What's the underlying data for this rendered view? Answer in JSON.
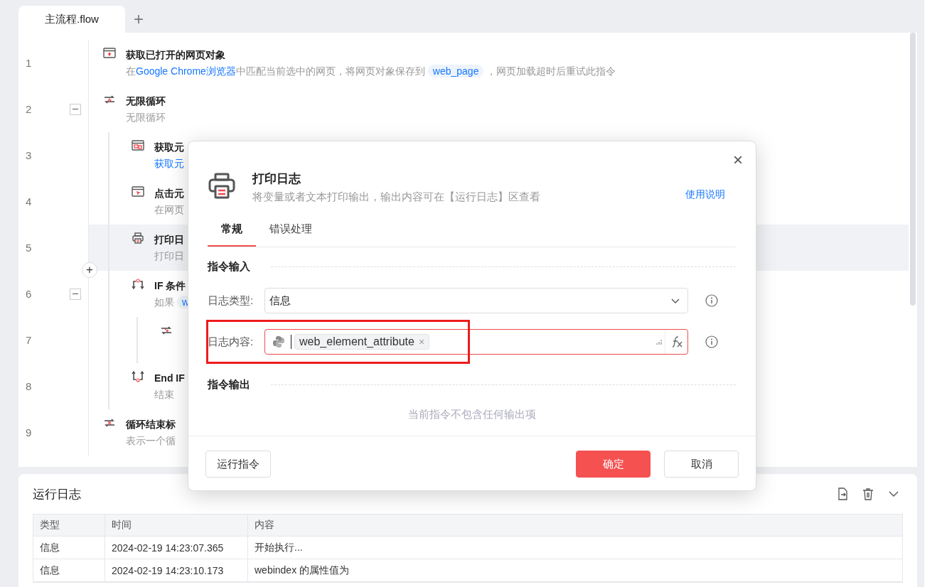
{
  "editor": {
    "tabs": [
      {
        "label": "主流程.flow",
        "selected": true
      }
    ],
    "add_tab": "+",
    "steps": [
      {
        "line": "1",
        "kind": "browser",
        "title": "获取已打开的网页对象",
        "description": [
          {
            "kind": "text",
            "text": "在"
          },
          {
            "kind": "link",
            "text": "Google Chrome浏览器"
          },
          {
            "kind": "text",
            "text": "中匹配当前选中的网页，将网页对象保存到"
          },
          {
            "kind": "tag",
            "text": "web_page"
          },
          {
            "kind": "text",
            "text": "，网页加载超时后重试此指令"
          }
        ],
        "selected": false
      },
      {
        "line": "2",
        "kind": "loop",
        "title": "无限循环",
        "description": [
          {
            "kind": "text",
            "text": "无限循环"
          }
        ],
        "selected": false,
        "expanded": true,
        "children": [
          {
            "line": "3",
            "kind": "element",
            "title": "获取元",
            "description": [
              {
                "kind": "link",
                "text": "获取元"
              }
            ],
            "selected": false
          },
          {
            "line": "4",
            "kind": "click",
            "title": "点击元",
            "description": [
              {
                "kind": "text",
                "text": "在网页"
              }
            ],
            "selected": false
          },
          {
            "line": "5",
            "kind": "printer",
            "title": "打印日",
            "description": [
              {
                "kind": "text",
                "text": "打印日"
              }
            ],
            "selected": true
          },
          {
            "line": "6",
            "kind": "if",
            "title": "IF 条件",
            "description": [
              {
                "kind": "text",
                "text": "如果"
              },
              {
                "kind": "tag",
                "text": "w"
              }
            ],
            "selected": false,
            "expanded": true,
            "children": [
              {
                "line": "7",
                "kind": "continue",
                "selected": false
              }
            ]
          },
          {
            "line": "8",
            "kind": "endif",
            "title": "End IF",
            "description": [
              {
                "kind": "text",
                "text": "结束"
              }
            ],
            "selected": false
          }
        ]
      },
      {
        "line": "9",
        "kind": "loopend",
        "title": "循环结束标",
        "description": [
          {
            "kind": "text",
            "text": "表示一个循"
          }
        ],
        "selected": false
      }
    ]
  },
  "log": {
    "title": "运行日志",
    "columns": [
      "类型",
      "时间",
      "内容"
    ],
    "rows": [
      [
        "信息",
        "2024-02-19 14:23:07.365",
        "开始执行..."
      ],
      [
        "信息",
        "2024-02-19 14:23:10.173",
        "webindex 的属性值为"
      ]
    ]
  },
  "dialog": {
    "title": "打印日志",
    "description": "将变量或者文本打印输出，输出内容可在【运行日志】区查看",
    "help_link": "使用说明",
    "close": "×",
    "tabs": [
      {
        "label": "常规",
        "selected": true
      },
      {
        "label": "错误处理",
        "selected": false
      }
    ],
    "input_section": "指令输入",
    "fields": [
      {
        "kind": "select",
        "label": "日志类型:",
        "value": "信息",
        "highlighted": false
      },
      {
        "kind": "expression",
        "label": "日志内容:",
        "token": "web_element_attribute",
        "token_remove": "×",
        "highlighted": true
      }
    ],
    "output_section": "指令输出",
    "output_empty": "当前指令不包含任何输出项",
    "buttons": [
      {
        "kind": "secondary",
        "label": "运行指令"
      },
      {
        "kind": "primary",
        "label": "确定"
      },
      {
        "kind": "default",
        "label": "取消"
      }
    ]
  }
}
